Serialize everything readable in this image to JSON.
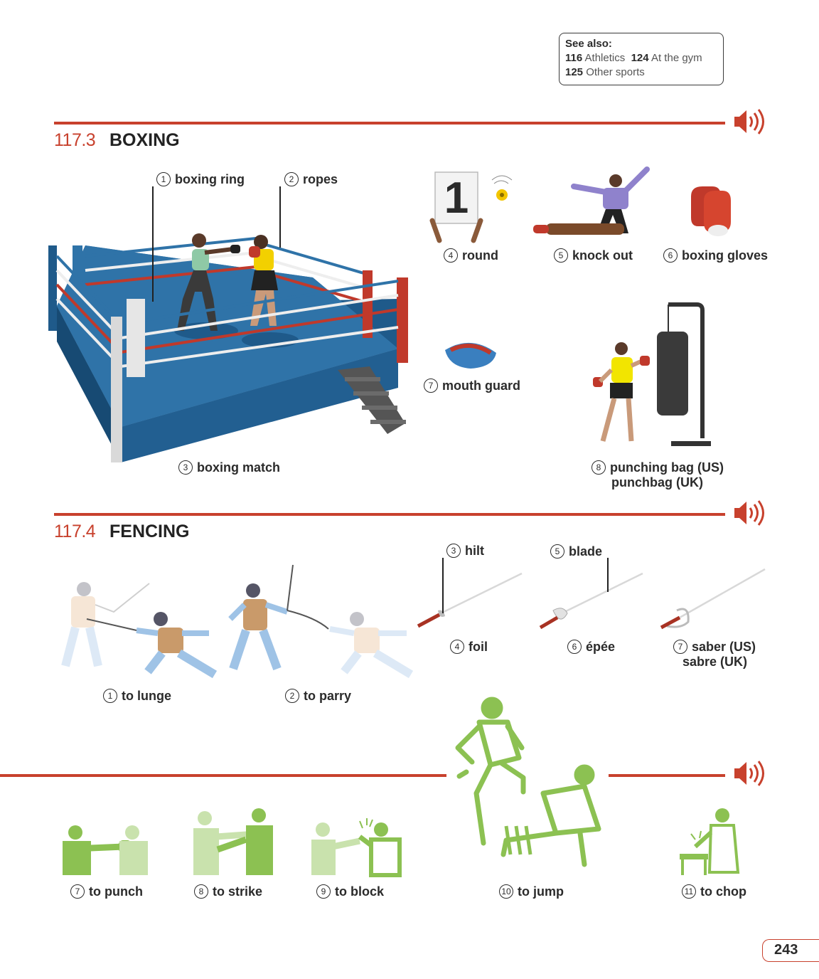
{
  "see_also": {
    "title": "See also:",
    "refs": [
      {
        "num": "116",
        "label": "Athletics"
      },
      {
        "num": "124",
        "label": "At the gym"
      },
      {
        "num": "125",
        "label": "Other sports"
      }
    ]
  },
  "boxing": {
    "number": "117.3",
    "title": "BOXING",
    "items": [
      {
        "n": "1",
        "label": "boxing ring"
      },
      {
        "n": "2",
        "label": "ropes"
      },
      {
        "n": "3",
        "label": "boxing match"
      },
      {
        "n": "4",
        "label": "round"
      },
      {
        "n": "5",
        "label": "knock out"
      },
      {
        "n": "6",
        "label": "boxing gloves"
      },
      {
        "n": "7",
        "label": "mouth guard"
      },
      {
        "n": "8",
        "label": "punching bag (US)",
        "label2": "punchbag (UK)"
      }
    ],
    "round_card": "1"
  },
  "fencing": {
    "number": "117.4",
    "title": "FENCING",
    "items": [
      {
        "n": "1",
        "label": "to lunge"
      },
      {
        "n": "2",
        "label": "to parry"
      },
      {
        "n": "3",
        "label": "hilt"
      },
      {
        "n": "4",
        "label": "foil"
      },
      {
        "n": "5",
        "label": "blade"
      },
      {
        "n": "6",
        "label": "épée"
      },
      {
        "n": "7",
        "label": "saber (US)",
        "label2": "sabre (UK)"
      }
    ]
  },
  "martial_arts": {
    "items": [
      {
        "n": "7",
        "label": "to punch"
      },
      {
        "n": "8",
        "label": "to strike"
      },
      {
        "n": "9",
        "label": "to block"
      },
      {
        "n": "10",
        "label": "to jump"
      },
      {
        "n": "11",
        "label": "to chop"
      }
    ]
  },
  "page_number": "243",
  "icons": {
    "audio": "speaker-icon"
  },
  "colors": {
    "accent": "#c8412d",
    "green": "#8cc152",
    "ring_blue": "#2f73a8"
  }
}
